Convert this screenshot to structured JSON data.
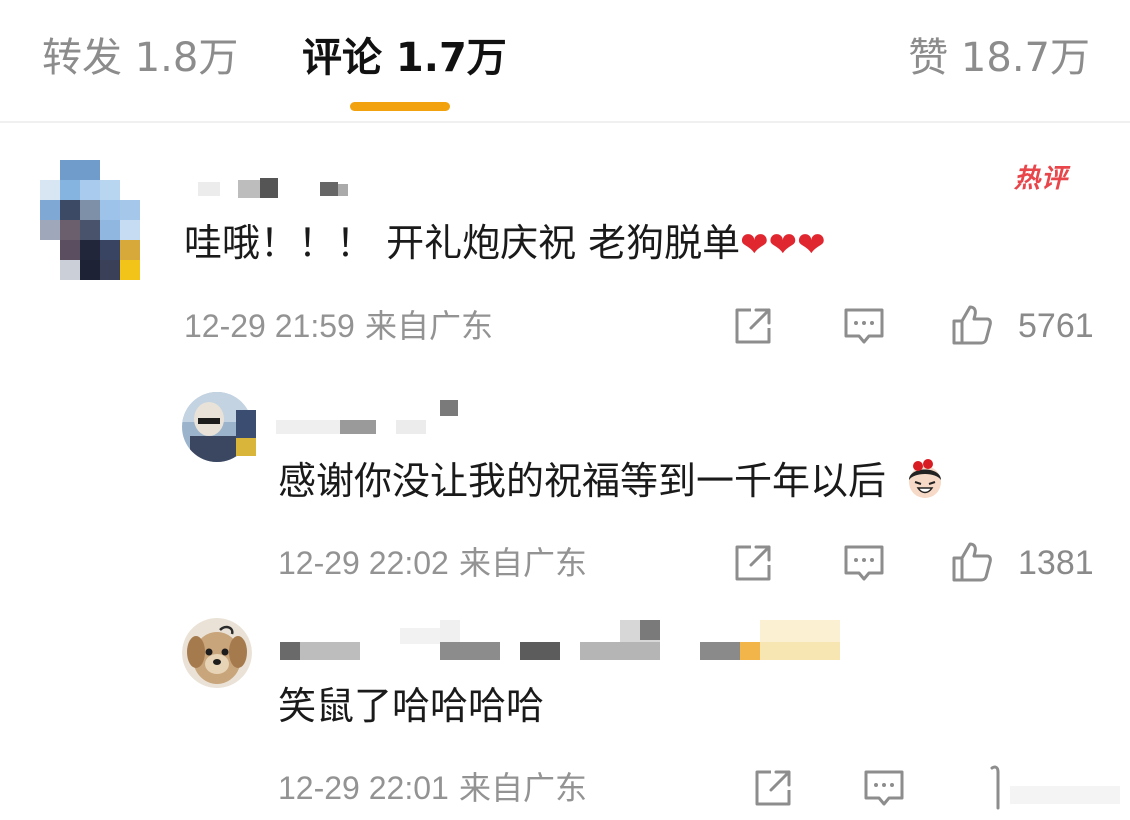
{
  "tabs": {
    "repost": "转发 1.8万",
    "comments": "评论 1.7万",
    "likes": "赞 18.7万"
  },
  "comments": [
    {
      "badge": "热评",
      "text": "哇哦！！！ 开礼炮庆祝 老狗脱单",
      "emoji": "❤❤❤",
      "timestamp": "12-29 21:59",
      "location": "来自广东",
      "like_count": "5761"
    },
    {
      "text": "感谢你没让我的祝福等到一千年以后",
      "timestamp": "12-29 22:02",
      "location": "来自广东",
      "like_count": "1381"
    },
    {
      "text": "笑鼠了哈哈哈哈",
      "timestamp": "12-29 22:01",
      "location": "来自广东",
      "like_count": ""
    }
  ],
  "icons": [
    "share-icon",
    "reply-icon",
    "thumbs-up-icon",
    "laugh-emoji-icon",
    "dog-avatar"
  ],
  "colors": {
    "accent": "#f2a20f",
    "hot": "#e8464a",
    "heart": "#e0262f",
    "meta": "#939393"
  }
}
